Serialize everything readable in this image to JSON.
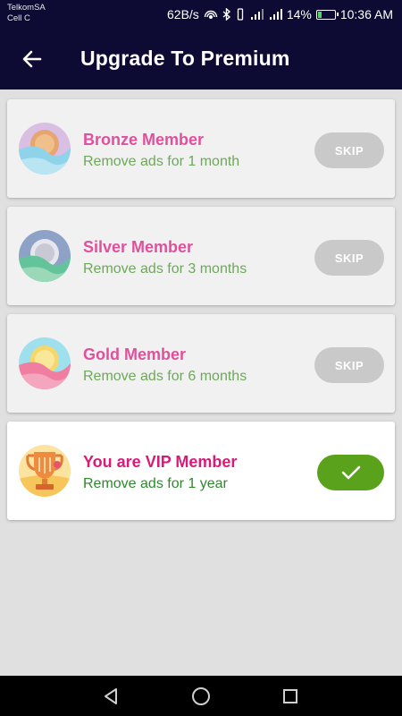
{
  "status_bar": {
    "carrier_line1": "TelkomSA",
    "carrier_line2": "Cell C",
    "speed": "62B/s",
    "battery_percent": "14%",
    "time": "10:36 AM"
  },
  "app_bar": {
    "title": "Upgrade To Premium"
  },
  "plans": [
    {
      "title": "Bronze Member",
      "subtitle": "Remove ads for 1 month",
      "button": "SKIP"
    },
    {
      "title": "Silver Member",
      "subtitle": "Remove ads for 3 months",
      "button": "SKIP"
    },
    {
      "title": "Gold Member",
      "subtitle": "Remove ads for 6 months",
      "button": "SKIP"
    },
    {
      "title": "You are VIP Member",
      "subtitle": "Remove ads for 1 year",
      "active": true
    }
  ],
  "colors": {
    "header_bg": "#0d0b33",
    "title_pink": "#e0509c",
    "subtitle_green": "#6ea85a",
    "check_green": "#5aa11c",
    "skip_gray": "#c9c9c9"
  },
  "icons": {
    "back": "arrow-left-icon",
    "bronze": "bronze-medal-icon",
    "silver": "silver-medal-icon",
    "gold": "gold-medal-icon",
    "vip": "trophy-icon",
    "check": "checkmark-icon",
    "nav_back": "triangle-back-icon",
    "nav_home": "circle-home-icon",
    "nav_recent": "square-recent-icon"
  }
}
